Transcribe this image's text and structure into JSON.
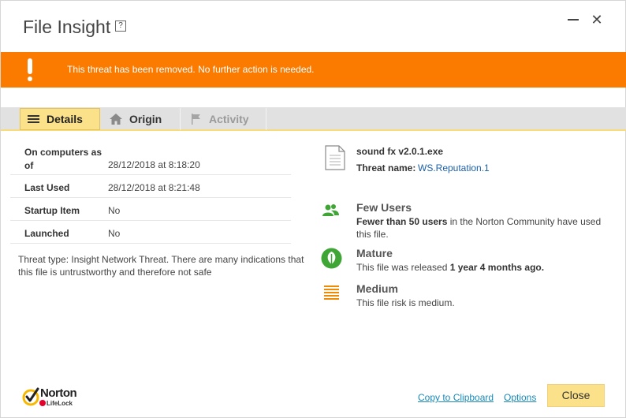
{
  "window": {
    "title": "File Insight",
    "help_label": "?",
    "close_glyph": "✕"
  },
  "banner": {
    "message": "This threat has been removed. No further action is needed.",
    "color": "#fa7b00"
  },
  "tabs": [
    {
      "label": "Details",
      "icon": "list-icon",
      "selected": true
    },
    {
      "label": "Origin",
      "icon": "home-icon",
      "selected": false
    },
    {
      "label": "Activity",
      "icon": "flag-icon",
      "selected": false,
      "disabled": true
    }
  ],
  "details": [
    {
      "label": "On computers as of",
      "value": "28/12/2018 at 8:18:20"
    },
    {
      "label": "Last Used",
      "value": "28/12/2018 at 8:21:48"
    },
    {
      "label": "Startup Item",
      "value": "No"
    },
    {
      "label": "Launched",
      "value": "No"
    }
  ],
  "threat_description": "Threat type: Insight Network Threat. There are many indications that this file is untrustworthy and therefore not safe",
  "file": {
    "name": "sound fx v2.0.1.exe",
    "threat_name_label": "Threat name:",
    "threat_name_value": "WS.Reputation.1"
  },
  "insights": [
    {
      "icon": "users-icon",
      "title": "Few Users",
      "desc_bold": "Fewer than 50 users",
      "desc_rest": " in the Norton Community have used this file."
    },
    {
      "icon": "leaf-icon",
      "title": "Mature",
      "desc_prefix": "This file was released ",
      "desc_bold": "1 year 4 months ago."
    },
    {
      "icon": "risk-icon",
      "title": "Medium",
      "desc": "This file risk is medium."
    }
  ],
  "footer": {
    "logo_name": "Norton",
    "logo_sub": "LifeLock",
    "copy_link": "Copy to Clipboard",
    "options_link": "Options",
    "close_button": "Close"
  },
  "colors": {
    "accent_yellow": "#fbe18a",
    "link_blue": "#1a8ab8",
    "green": "#3fa535",
    "orange": "#f08a00"
  }
}
